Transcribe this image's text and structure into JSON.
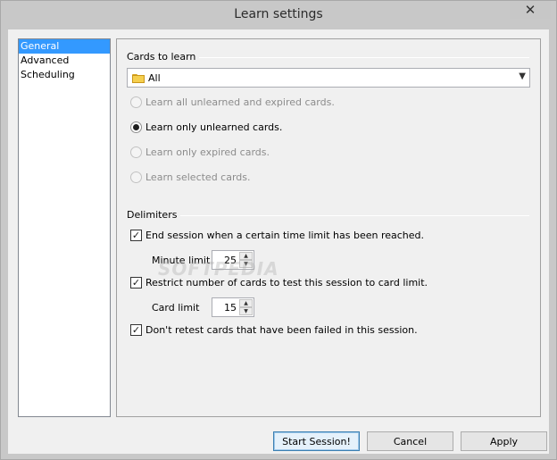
{
  "window": {
    "title": "Learn settings",
    "close_glyph": "✕"
  },
  "nav": {
    "items": [
      {
        "label": "General",
        "selected": true
      },
      {
        "label": "Advanced",
        "selected": false
      },
      {
        "label": "Scheduling",
        "selected": false
      }
    ]
  },
  "cards_to_learn": {
    "group_label": "Cards to learn",
    "combo_value": "All",
    "combo_icon": "folder-icon",
    "options": [
      {
        "label": "Learn all unlearned and expired cards.",
        "checked": false,
        "enabled": false
      },
      {
        "label": "Learn only unlearned cards.",
        "checked": true,
        "enabled": true
      },
      {
        "label": "Learn only expired cards.",
        "checked": false,
        "enabled": false
      },
      {
        "label": "Learn selected cards.",
        "checked": false,
        "enabled": false
      }
    ]
  },
  "delimiters": {
    "group_label": "Delimiters",
    "end_session_label": "End session when a certain time limit has been reached.",
    "end_session_checked": true,
    "minute_limit_label": "Minute limit",
    "minute_limit_value": "25",
    "restrict_label": "Restrict number of cards to test this session to card limit.",
    "restrict_checked": true,
    "card_limit_label": "Card limit",
    "card_limit_value": "15",
    "no_retest_label": "Don't retest cards that have been failed in this session.",
    "no_retest_checked": true
  },
  "watermark": "SOFTPEDIA",
  "buttons": {
    "start": "Start Session!",
    "cancel": "Cancel",
    "apply": "Apply"
  }
}
